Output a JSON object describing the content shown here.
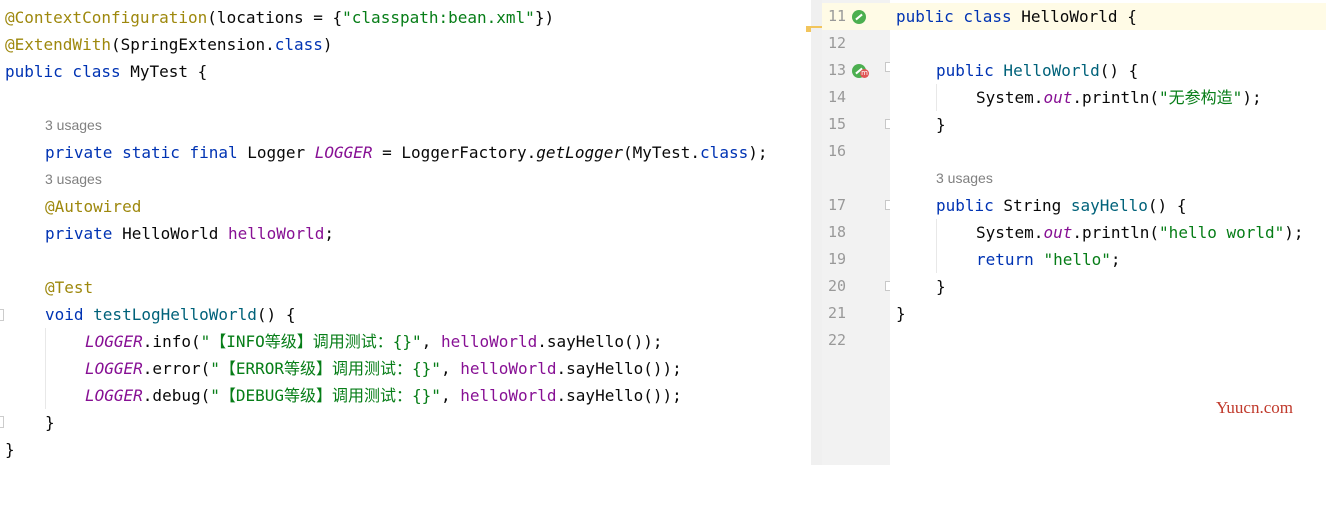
{
  "left": {
    "line_context_config": {
      "ann": "@ContextConfiguration",
      "rest1": "(locations = {",
      "str": "\"classpath:bean.xml\"",
      "rest2": "})"
    },
    "line_extend": {
      "ann": "@ExtendWith",
      "rest1": "(SpringExtension.",
      "kw": "class",
      "rest2": ")"
    },
    "line_class": {
      "kw": "public class",
      "rest": " MyTest {"
    },
    "usages_1": "3 usages",
    "line_logger": {
      "kw": "private static final",
      "type": " Logger ",
      "field": "LOGGER",
      "eq": " = LoggerFactory.",
      "method": "getLogger",
      "rest1": "(MyTest.",
      "kw2": "class",
      "rest2": ");"
    },
    "usages_2": "3 usages",
    "line_autowired": "@Autowired",
    "line_field": {
      "kw": "private",
      "type": " HelloWorld ",
      "field": "helloWorld",
      "rest": ";"
    },
    "line_test_ann": "@Test",
    "line_method": {
      "kw": "void",
      "name": " testLogHelloWorld",
      "rest": "() {"
    },
    "line_info": {
      "field": "LOGGER",
      "call": ".info(",
      "str": "\"【INFO等级】调用测试：{}\"",
      "sep": ", ",
      "arg": "helloWorld",
      "rest": ".sayHello());"
    },
    "line_error": {
      "field": "LOGGER",
      "call": ".error(",
      "str": "\"【ERROR等级】调用测试：{}\"",
      "sep": ", ",
      "arg": "helloWorld",
      "rest": ".sayHello());"
    },
    "line_debug": {
      "field": "LOGGER",
      "call": ".debug(",
      "str": "\"【DEBUG等级】调用测试：{}\"",
      "sep": ", ",
      "arg": "helloWorld",
      "rest": ".sayHello());"
    },
    "close_method": "}",
    "close_class": "}"
  },
  "right": {
    "line_numbers": [
      "11",
      "12",
      "13",
      "14",
      "15",
      "16",
      "17",
      "18",
      "19",
      "20",
      "21",
      "22"
    ],
    "line_class": {
      "kw": "public class",
      "rest": " HelloWorld {"
    },
    "line_ctor": {
      "kw": "public",
      "name": " HelloWorld",
      "rest": "() {"
    },
    "line_println1": {
      "pre": "System.",
      "field": "out",
      "mid": ".println(",
      "str": "\"无参构造\"",
      "rest": ");"
    },
    "close_ctor": "}",
    "usages": "3 usages",
    "line_say": {
      "kw": "public",
      "type": " String ",
      "name": "sayHello",
      "rest": "() {"
    },
    "line_println2": {
      "pre": "System.",
      "field": "out",
      "mid": ".println(",
      "str": "\"hello world\"",
      "rest": ");"
    },
    "line_return": {
      "kw": "return",
      "sp": " ",
      "str": "\"hello\"",
      "rest": ";"
    },
    "close_say": "}",
    "close_class": "}"
  },
  "watermark": "Yuucn.com",
  "colors": {
    "keyword": "#0033b3",
    "annotation": "#9e880d",
    "string": "#067d17",
    "field": "#871094",
    "method": "#00627a",
    "hint": "#808080"
  },
  "icons": [
    "run-test-icon",
    "method-badge-icon",
    "fold-icon"
  ]
}
